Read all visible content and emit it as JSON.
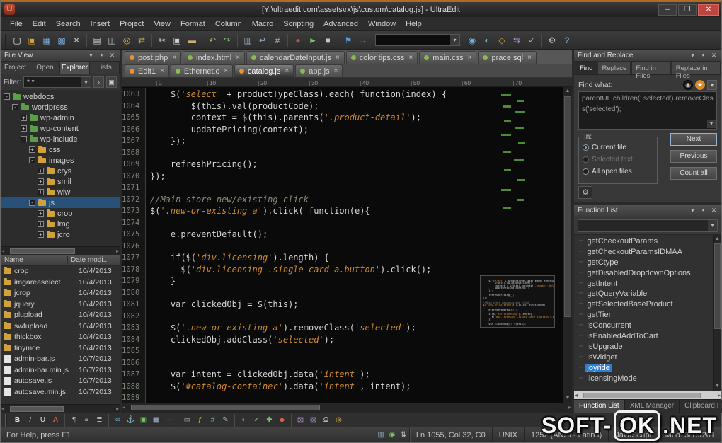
{
  "window": {
    "title": "[Y:\\ultraedit.com\\assets\\rx\\js\\custom\\catalog.js] - UltraEdit",
    "app_icon_letter": "U",
    "controls": {
      "minimize": "–",
      "maximize": "❐",
      "close": "✕"
    }
  },
  "menubar": {
    "items": [
      "File",
      "Edit",
      "Search",
      "Insert",
      "Project",
      "View",
      "Format",
      "Column",
      "Macro",
      "Scripting",
      "Advanced",
      "Window",
      "Help"
    ]
  },
  "toolbar_top": {
    "icons_left": [
      {
        "name": "new-file-icon",
        "glyph": "▢",
        "color": "#e6e6e6"
      },
      {
        "name": "open-file-icon",
        "glyph": "▣",
        "color": "#d9a33c"
      },
      {
        "name": "save-file-icon",
        "glyph": "▦",
        "color": "#7aa7d9"
      },
      {
        "name": "save-all-icon",
        "glyph": "▩",
        "color": "#7aa7d9"
      },
      {
        "name": "close-file-icon",
        "glyph": "✕",
        "color": "#b9b9b9"
      },
      {
        "sep": true
      },
      {
        "name": "print-icon",
        "glyph": "▤",
        "color": "#c9c9c9"
      },
      {
        "name": "print-preview-icon",
        "glyph": "◫",
        "color": "#c9c9c9"
      },
      {
        "name": "find-icon",
        "glyph": "◎",
        "color": "#e2b14f"
      },
      {
        "name": "replace-icon",
        "glyph": "⇄",
        "color": "#e2b14f"
      },
      {
        "sep": true
      },
      {
        "name": "cut-icon",
        "glyph": "✂",
        "color": "#d0d0d0"
      },
      {
        "name": "copy-icon",
        "glyph": "▣",
        "color": "#d0d0d0"
      },
      {
        "name": "paste-icon",
        "glyph": "▬",
        "color": "#cdb078"
      },
      {
        "sep": true
      },
      {
        "name": "undo-icon",
        "glyph": "↶",
        "color": "#8fc06a"
      },
      {
        "name": "redo-icon",
        "glyph": "↷",
        "color": "#8fc06a"
      },
      {
        "sep": true
      },
      {
        "name": "column-mode-icon",
        "glyph": "▥",
        "color": "#9fb3c8"
      },
      {
        "name": "word-wrap-icon",
        "glyph": "↵",
        "color": "#9fb3c8"
      },
      {
        "name": "hex-mode-icon",
        "glyph": "#",
        "color": "#9fb3c8"
      },
      {
        "sep": true
      },
      {
        "name": "macro-record-icon",
        "glyph": "●",
        "color": "#c05048"
      },
      {
        "name": "macro-play-icon",
        "glyph": "►",
        "color": "#7ac36a"
      },
      {
        "name": "macro-stop-icon",
        "glyph": "■",
        "color": "#c9c9c9"
      },
      {
        "sep": true
      },
      {
        "name": "bookmark-icon",
        "glyph": "⚑",
        "color": "#5b9bd5"
      },
      {
        "name": "goto-line-icon",
        "glyph": "→",
        "color": "#c9c9c9"
      }
    ],
    "icons_right": [
      {
        "name": "ftp-icon",
        "glyph": "◉",
        "color": "#6fb3d8"
      },
      {
        "name": "browser-view-icon",
        "glyph": "◐",
        "color": "#6fb3d8"
      },
      {
        "name": "tag-list-icon",
        "glyph": "◇",
        "color": "#d8a040"
      },
      {
        "name": "compare-icon",
        "glyph": "⇆",
        "color": "#b08fd0"
      },
      {
        "name": "spell-check-icon",
        "glyph": "✓",
        "color": "#7ac36a"
      },
      {
        "sep": true
      },
      {
        "name": "settings-icon",
        "glyph": "⚙",
        "color": "#c9c9c9"
      },
      {
        "name": "help-icon",
        "glyph": "?",
        "color": "#6fb3d8"
      }
    ]
  },
  "toolbar_bottom": {
    "icons": [
      {
        "name": "html-bold-icon",
        "glyph": "B",
        "color": "#e8e8e8",
        "bold": true
      },
      {
        "name": "html-italic-icon",
        "glyph": "I",
        "color": "#e8e8e8",
        "italic": true
      },
      {
        "name": "html-underline-icon",
        "glyph": "U",
        "color": "#e8e8e8"
      },
      {
        "name": "font-color-icon",
        "glyph": "A",
        "color": "#d9604c",
        "bold": true
      },
      {
        "sep": true
      },
      {
        "name": "paragraph-icon",
        "glyph": "¶",
        "color": "#b9c7d6"
      },
      {
        "name": "bullet-list-icon",
        "glyph": "≡",
        "color": "#9fb3c8"
      },
      {
        "name": "numbered-list-icon",
        "glyph": "≣",
        "color": "#9fb3c8"
      },
      {
        "sep": true
      },
      {
        "name": "link-icon",
        "glyph": "∞",
        "color": "#6fb3d8"
      },
      {
        "name": "anchor-icon",
        "glyph": "⚓",
        "color": "#6fb3d8"
      },
      {
        "name": "image-icon",
        "glyph": "▣",
        "color": "#7ac36a"
      },
      {
        "name": "table-icon",
        "glyph": "▦",
        "color": "#9fb3c8"
      },
      {
        "name": "hr-icon",
        "glyph": "—",
        "color": "#c9c9c9"
      },
      {
        "sep": true
      },
      {
        "name": "form-icon",
        "glyph": "▭",
        "color": "#c9c9c9"
      },
      {
        "name": "script-icon",
        "glyph": "ƒ",
        "color": "#e2b14f"
      },
      {
        "name": "style-icon",
        "glyph": "#",
        "color": "#6fb3d8"
      },
      {
        "name": "comment-icon",
        "glyph": "✎",
        "color": "#c9c9c9"
      },
      {
        "sep": true
      },
      {
        "name": "preview-icon",
        "glyph": "◐",
        "color": "#6fb3d8"
      },
      {
        "name": "validate-icon",
        "glyph": "✓",
        "color": "#7ac36a"
      },
      {
        "name": "cleanup-icon",
        "glyph": "✚",
        "color": "#7ac36a"
      },
      {
        "name": "palette-icon",
        "glyph": "◆",
        "color": "#d9604c"
      },
      {
        "sep": true
      },
      {
        "name": "template-icon",
        "glyph": "▧",
        "color": "#b08fd0"
      },
      {
        "name": "snippet-icon",
        "glyph": "▨",
        "color": "#b08fd0"
      },
      {
        "name": "special-char-icon",
        "glyph": "Ω",
        "color": "#c9c9c9"
      },
      {
        "name": "date-time-icon",
        "glyph": "◎",
        "color": "#e2b14f"
      }
    ]
  },
  "file_view": {
    "title": "File View",
    "tabs": [
      "Project",
      "Open",
      "Explorer",
      "Lists"
    ],
    "active_tab": "Explorer",
    "filter_label": "Filter:",
    "filter_value": "*.*",
    "tree": [
      {
        "label": "webdocs",
        "depth": 0,
        "expander": "-",
        "color": "green"
      },
      {
        "label": "wordpress",
        "depth": 1,
        "expander": "-",
        "color": "green"
      },
      {
        "label": "wp-admin",
        "depth": 2,
        "expander": "+",
        "color": "green"
      },
      {
        "label": "wp-content",
        "depth": 2,
        "expander": "+",
        "color": "green"
      },
      {
        "label": "wp-include",
        "depth": 2,
        "expander": "-",
        "color": "green"
      },
      {
        "label": "css",
        "depth": 3,
        "expander": "+",
        "color": "yellow"
      },
      {
        "label": "images",
        "depth": 3,
        "expander": "-",
        "color": "yellow"
      },
      {
        "label": "crys",
        "depth": 4,
        "expander": "+",
        "color": "yellow"
      },
      {
        "label": "smil",
        "depth": 4,
        "expander": "+",
        "color": "yellow"
      },
      {
        "label": "wlw",
        "depth": 4,
        "expander": "+",
        "color": "yellow"
      },
      {
        "label": "js",
        "depth": 3,
        "expander": "-",
        "color": "yellow",
        "selected": true
      },
      {
        "label": "crop",
        "depth": 4,
        "expander": "+",
        "color": "yellow"
      },
      {
        "label": "img",
        "depth": 4,
        "expander": "+",
        "color": "yellow"
      },
      {
        "label": "jcro",
        "depth": 4,
        "expander": "+",
        "color": "yellow"
      }
    ],
    "list_columns": [
      "Name",
      "Date modi..."
    ],
    "files": [
      {
        "name": "crop",
        "date": "10/4/2013",
        "type": "folder"
      },
      {
        "name": "imgareaselect",
        "date": "10/4/2013",
        "type": "folder"
      },
      {
        "name": "jcrop",
        "date": "10/4/2013",
        "type": "folder"
      },
      {
        "name": "jquery",
        "date": "10/4/2013",
        "type": "folder"
      },
      {
        "name": "plupload",
        "date": "10/4/2013",
        "type": "folder"
      },
      {
        "name": "swfupload",
        "date": "10/4/2013",
        "type": "folder"
      },
      {
        "name": "thickbox",
        "date": "10/4/2013",
        "type": "folder"
      },
      {
        "name": "tinymce",
        "date": "10/4/2013",
        "type": "folder"
      },
      {
        "name": "admin-bar.js",
        "date": "10/7/2013",
        "type": "file"
      },
      {
        "name": "admin-bar.min.js",
        "date": "10/7/2013",
        "type": "file"
      },
      {
        "name": "autosave.js",
        "date": "10/7/2013",
        "type": "file"
      },
      {
        "name": "autosave.min.js",
        "date": "10/7/2013",
        "type": "file"
      }
    ]
  },
  "editor": {
    "tab_row1": [
      {
        "label": "post.php",
        "dot": "orange"
      },
      {
        "label": "index.html",
        "dot": "green"
      },
      {
        "label": "calendarDateInput.js",
        "dot": "green"
      },
      {
        "label": "color tips.css",
        "dot": "green"
      },
      {
        "label": "main.css",
        "dot": "green"
      },
      {
        "label": "prace.sql",
        "dot": "green"
      }
    ],
    "tab_row2": [
      {
        "label": "Edit1",
        "dot": "orange"
      },
      {
        "label": "Ethernet.c",
        "dot": "green"
      },
      {
        "label": "catalog.js",
        "dot": "orange",
        "active": true
      },
      {
        "label": "app.js",
        "dot": "green"
      }
    ],
    "ruler_marks": [
      "0",
      "10",
      "20",
      "30",
      "40",
      "50",
      "60",
      "70"
    ],
    "lines": [
      {
        "n": 1063,
        "seg": [
          [
            "p",
            "    $("
          ],
          [
            "s",
            "'select'"
          ],
          [
            "p",
            " + productTypeClass).each( function(index) {"
          ]
        ]
      },
      {
        "n": 1064,
        "seg": [
          [
            "p",
            "        $(this).val(productCode);"
          ]
        ]
      },
      {
        "n": 1065,
        "seg": [
          [
            "p",
            "        context = $(this).parents("
          ],
          [
            "s",
            "'.product-detail'"
          ],
          [
            "p",
            ");"
          ]
        ]
      },
      {
        "n": 1066,
        "seg": [
          [
            "p",
            "        updatePricing(context);"
          ]
        ]
      },
      {
        "n": 1067,
        "seg": [
          [
            "p",
            "    });"
          ]
        ]
      },
      {
        "n": 1068,
        "seg": []
      },
      {
        "n": 1069,
        "seg": [
          [
            "p",
            "    refreshPricing();"
          ]
        ]
      },
      {
        "n": 1070,
        "seg": [
          [
            "p",
            "});"
          ]
        ]
      },
      {
        "n": 1071,
        "seg": []
      },
      {
        "n": 1072,
        "seg": [
          [
            "c",
            "//Main store new/existing click"
          ]
        ]
      },
      {
        "n": 1073,
        "seg": [
          [
            "p",
            "$("
          ],
          [
            "s",
            "'.new-or-existing a'"
          ],
          [
            "p",
            ").click( function(e){"
          ]
        ]
      },
      {
        "n": 1074,
        "seg": []
      },
      {
        "n": 1075,
        "seg": [
          [
            "p",
            "    e.preventDefault();"
          ]
        ]
      },
      {
        "n": 1076,
        "seg": []
      },
      {
        "n": 1077,
        "seg": [
          [
            "p",
            "    if($("
          ],
          [
            "s",
            "'div.licensing'"
          ],
          [
            "p",
            ").length) {"
          ]
        ]
      },
      {
        "n": 1078,
        "seg": [
          [
            "p",
            "      $("
          ],
          [
            "s",
            "'div.licensing .single-card a.button'"
          ],
          [
            "p",
            ").click();"
          ]
        ]
      },
      {
        "n": 1079,
        "seg": [
          [
            "p",
            "    }"
          ]
        ]
      },
      {
        "n": 1080,
        "seg": []
      },
      {
        "n": 1081,
        "seg": [
          [
            "p",
            "    var clickedObj = $(this);"
          ]
        ]
      },
      {
        "n": 1082,
        "seg": []
      },
      {
        "n": 1083,
        "seg": [
          [
            "p",
            "    $("
          ],
          [
            "s",
            "'.new-or-existing a'"
          ],
          [
            "p",
            ").removeClass("
          ],
          [
            "s",
            "'selected'"
          ],
          [
            "p",
            ");"
          ]
        ]
      },
      {
        "n": 1084,
        "seg": [
          [
            "p",
            "    clickedObj.addClass("
          ],
          [
            "s",
            "'selected'"
          ],
          [
            "p",
            ");"
          ]
        ]
      },
      {
        "n": 1085,
        "seg": []
      },
      {
        "n": 1086,
        "seg": []
      },
      {
        "n": 1087,
        "seg": [
          [
            "p",
            "    var intent = clickedObj.data("
          ],
          [
            "s",
            "'intent'"
          ],
          [
            "p",
            ");"
          ]
        ]
      },
      {
        "n": 1088,
        "seg": [
          [
            "p",
            "    $("
          ],
          [
            "s",
            "'#catalog-container'"
          ],
          [
            "p",
            ").data("
          ],
          [
            "s",
            "'intent'"
          ],
          [
            "p",
            ", intent);"
          ]
        ]
      },
      {
        "n": 1089,
        "seg": []
      }
    ]
  },
  "find_replace": {
    "title": "Find and Replace",
    "tabs": [
      "Find",
      "Replace",
      "Find in Files",
      "Replace in Files"
    ],
    "active_tab": "Find",
    "find_what_label": "Find what:",
    "find_value": "parentUL.children('.selected').removeClass('selected');",
    "in_label": "In:",
    "options": [
      {
        "label": "Current file",
        "selected": true,
        "disabled": false
      },
      {
        "label": "Selected text",
        "selected": false,
        "disabled": true
      },
      {
        "label": "All open files",
        "selected": false,
        "disabled": false
      }
    ],
    "buttons": [
      "Next",
      "Previous",
      "Count all"
    ]
  },
  "function_list": {
    "title": "Function List",
    "items": [
      "getCheckoutParams",
      "getCheckoutParamsIDMAA",
      "getCtype",
      "getDisabledDropdownOptions",
      "getIntent",
      "getQueryVariable",
      "getSelectedBaseProduct",
      "getTier",
      "isConcurrent",
      "isEnabledAddToCart",
      "isUpgrade",
      "isWidget",
      "joyride",
      "licensingMode"
    ],
    "selected": "joyride"
  },
  "panel_tabs": {
    "items": [
      "Function List",
      "XML Manager",
      "Clipboard Hi..."
    ],
    "active": "Function List"
  },
  "statusbar": {
    "help_text": "For Help, press F1",
    "icons": [
      {
        "name": "insert-mode-icon",
        "glyph": "▥",
        "color": "#9fb3c8"
      },
      {
        "name": "read-write-icon",
        "glyph": "◉",
        "color": "#7ac36a"
      },
      {
        "name": "sync-scroll-icon",
        "glyph": "⇅",
        "color": "#c9c9c9"
      }
    ],
    "segments": [
      "Ln 1055, Col 32, C0",
      "UNIX",
      "1252 (ANSI - Latin I)",
      "JavaScript",
      "Mod: 3/19/201"
    ]
  },
  "watermark": {
    "left": "SOFT-",
    "boxed": "OK",
    "right": ".NET"
  }
}
